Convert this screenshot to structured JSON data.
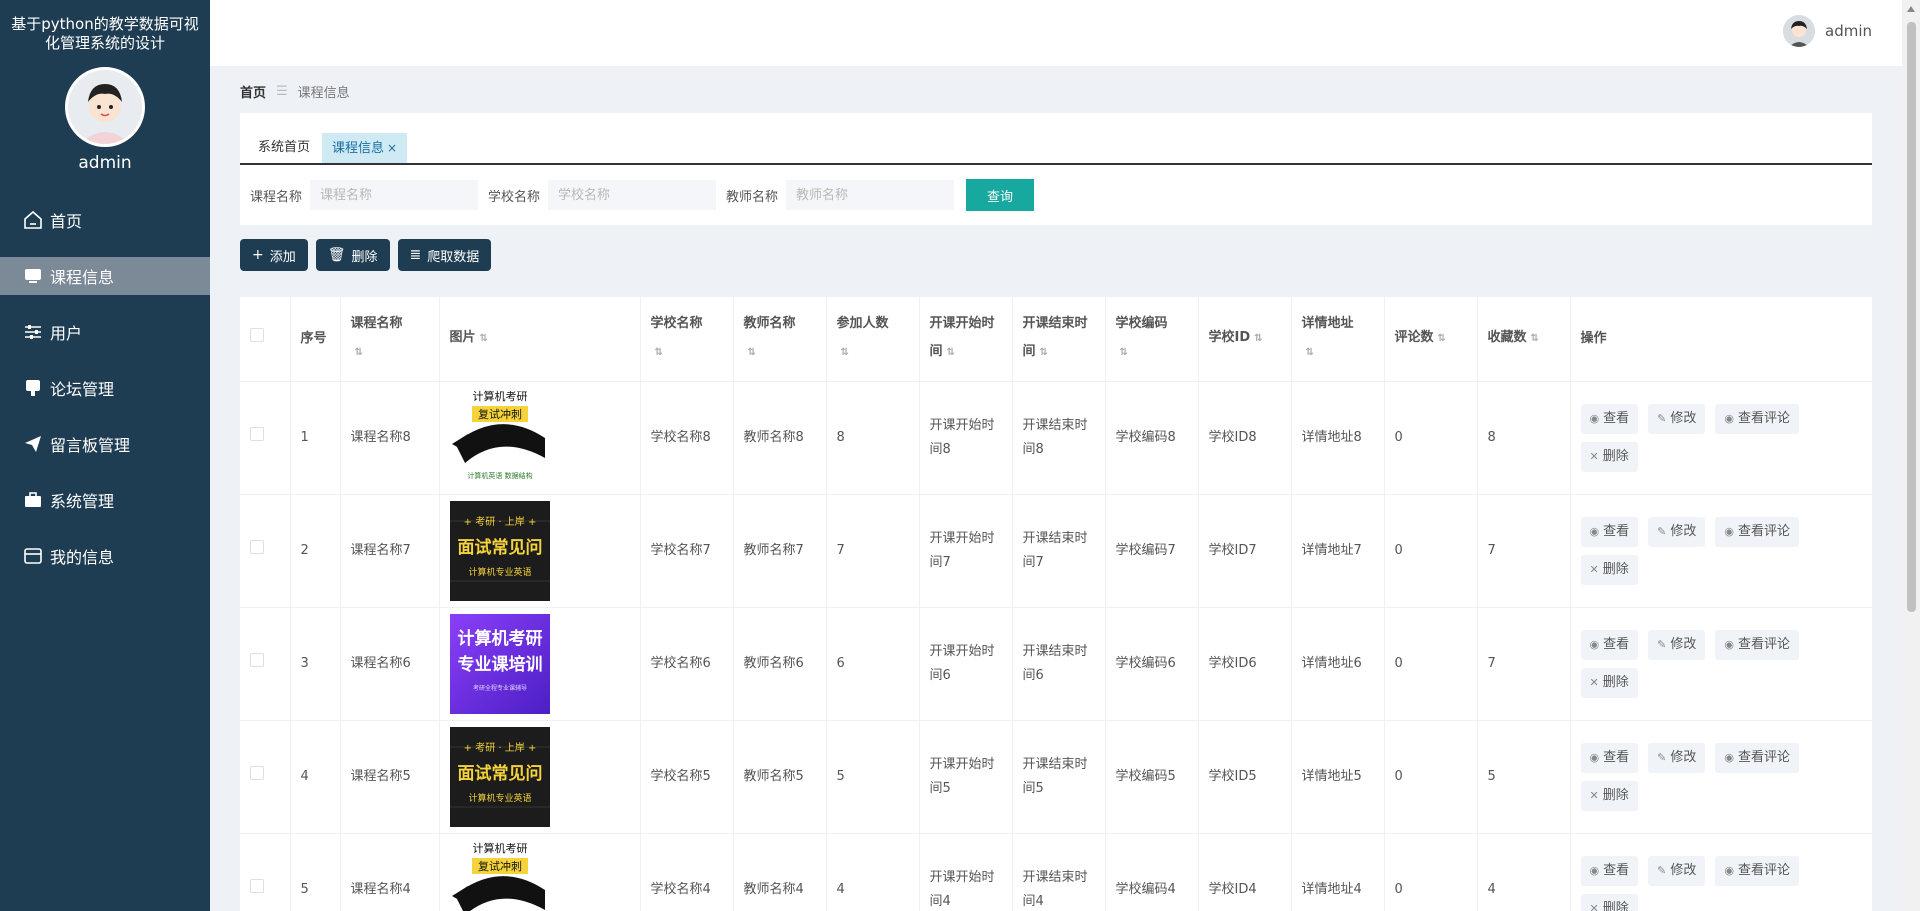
{
  "app": {
    "title": "基于python的教学数据可视化管理系统的设计",
    "username": "admin"
  },
  "sidebar": {
    "items": [
      {
        "label": "首页",
        "icon": "home-icon"
      },
      {
        "label": "课程信息",
        "icon": "monitor-icon",
        "active": true
      },
      {
        "label": "用户",
        "icon": "sliders-icon"
      },
      {
        "label": "论坛管理",
        "icon": "board-icon"
      },
      {
        "label": "留言板管理",
        "icon": "send-icon"
      },
      {
        "label": "系统管理",
        "icon": "briefcase-icon"
      },
      {
        "label": "我的信息",
        "icon": "card-icon"
      }
    ]
  },
  "header": {
    "username": "admin"
  },
  "breadcrumb": {
    "home": "首页",
    "current": "课程信息"
  },
  "tabs": [
    {
      "label": "系统首页"
    },
    {
      "label": "课程信息",
      "close": "×"
    }
  ],
  "search": {
    "course_label": "课程名称",
    "course_placeholder": "课程名称",
    "school_label": "学校名称",
    "school_placeholder": "学校名称",
    "teacher_label": "教师名称",
    "teacher_placeholder": "教师名称",
    "query_button": "查询"
  },
  "toolbar": {
    "add": "添加",
    "delete": "删除",
    "crawl": "爬取数据"
  },
  "table": {
    "headers": {
      "index": "序号",
      "course": "课程名称",
      "image": "图片",
      "school": "学校名称",
      "teacher": "教师名称",
      "participants": "参加人数",
      "start": "开课开始时间",
      "end": "开课结束时间",
      "school_code": "学校编码",
      "school_id": "学校ID",
      "detail": "详情地址",
      "comments": "评论数",
      "favorites": "收藏数",
      "ops": "操作"
    },
    "ops": {
      "view": "查看",
      "edit": "修改",
      "view_comments": "查看评论",
      "delete": "删除"
    },
    "rows": [
      {
        "index": "1",
        "course": "课程名称8",
        "school": "学校名称8",
        "teacher": "教师名称8",
        "participants": "8",
        "start": "开课开始时间8",
        "end": "开课结束时间8",
        "school_code": "学校编码8",
        "school_id": "学校ID8",
        "detail": "详情地址8",
        "comments": "0",
        "favorites": "8"
      },
      {
        "index": "2",
        "course": "课程名称7",
        "school": "学校名称7",
        "teacher": "教师名称7",
        "participants": "7",
        "start": "开课开始时间7",
        "end": "开课结束时间7",
        "school_code": "学校编码7",
        "school_id": "学校ID7",
        "detail": "详情地址7",
        "comments": "0",
        "favorites": "7"
      },
      {
        "index": "3",
        "course": "课程名称6",
        "school": "学校名称6",
        "teacher": "教师名称6",
        "participants": "6",
        "start": "开课开始时间6",
        "end": "开课结束时间6",
        "school_code": "学校编码6",
        "school_id": "学校ID6",
        "detail": "详情地址6",
        "comments": "0",
        "favorites": "7"
      },
      {
        "index": "4",
        "course": "课程名称5",
        "school": "学校名称5",
        "teacher": "教师名称5",
        "participants": "5",
        "start": "开课开始时间5",
        "end": "开课结束时间5",
        "school_code": "学校编码5",
        "school_id": "学校ID5",
        "detail": "详情地址5",
        "comments": "0",
        "favorites": "5"
      },
      {
        "index": "5",
        "course": "课程名称4",
        "school": "学校名称4",
        "teacher": "教师名称4",
        "participants": "4",
        "start": "开课开始时间4",
        "end": "开课结束时间4",
        "school_code": "学校编码4",
        "school_id": "学校ID4",
        "detail": "详情地址4",
        "comments": "0",
        "favorites": "4"
      }
    ]
  },
  "images": {
    "img_a": {
      "line1": "计算机考研",
      "line2": "复试冲刺",
      "line3": "计算机英语  数据结构"
    },
    "img_b": {
      "line1": "+ 考研 · 上岸 +",
      "line2": "面试常见问",
      "line3": "计算机专业英语"
    },
    "img_c": {
      "line1": "计算机考研",
      "line2": "专业课培训",
      "line3": "考研全程专业课辅导"
    }
  },
  "colors": {
    "sidebar": "#1f3d52",
    "accent": "#17a8a0",
    "active_tab": "#cfe9f5"
  }
}
